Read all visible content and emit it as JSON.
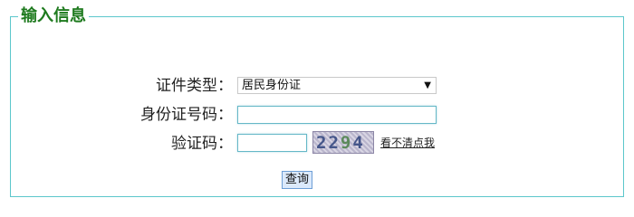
{
  "form": {
    "legend": "输入信息",
    "cert_type_label": "证件类型：",
    "cert_type_selected": "居民身份证",
    "id_number_label": "身份证号码：",
    "id_number_value": "",
    "captcha_label": "验证码：",
    "captcha_value": "",
    "captcha_image_text": [
      "2",
      "2",
      "9",
      "4"
    ],
    "refresh_captcha_link": "看不清点我",
    "submit_label": "查询"
  },
  "colors": {
    "legend": "#1e7a1e",
    "border": "#5cc7cc",
    "button_bg": "#dbe9fb",
    "input_border": "#66b8c7"
  }
}
